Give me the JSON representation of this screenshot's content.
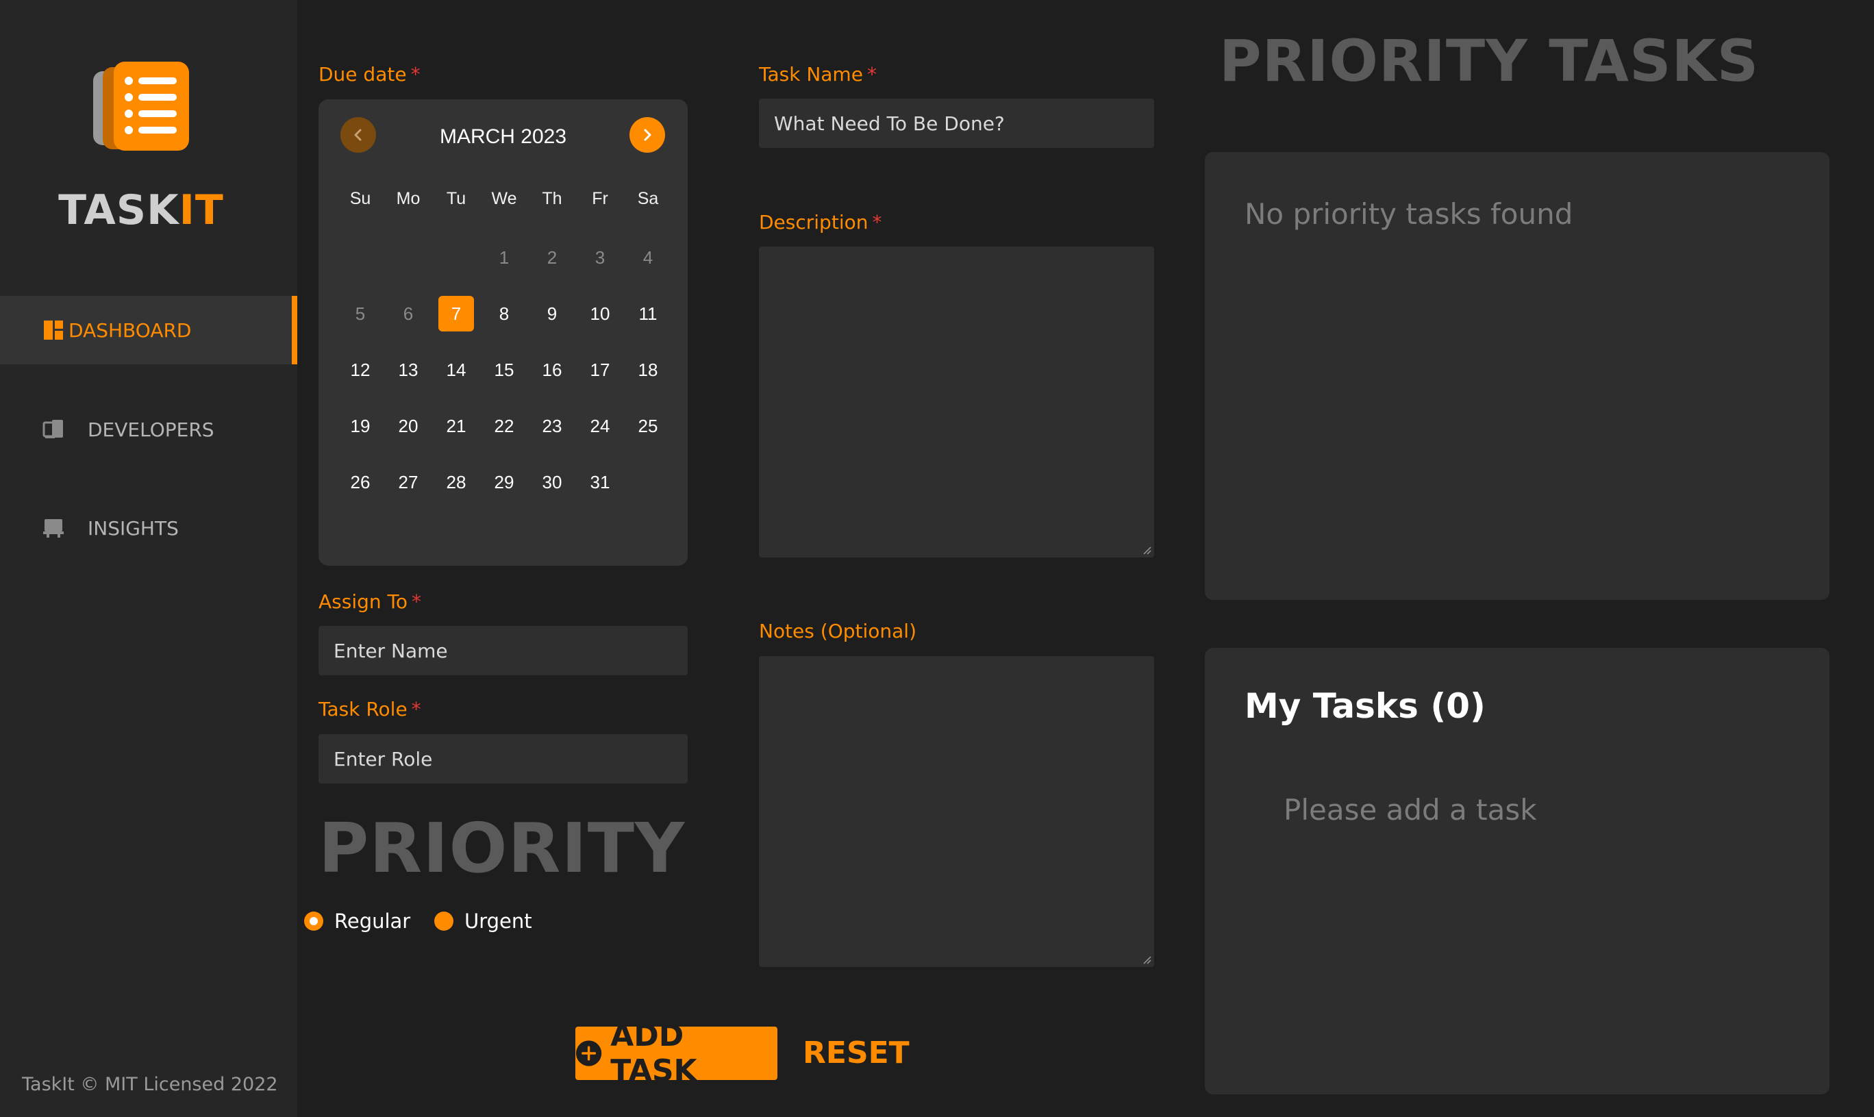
{
  "brand": {
    "part1": "TASK",
    "part2": "IT"
  },
  "nav": [
    {
      "label": "DASHBOARD",
      "active": true,
      "icon": "dashboard-icon"
    },
    {
      "label": "DEVELOPERS",
      "active": false,
      "icon": "developers-icon"
    },
    {
      "label": "INSIGHTS",
      "active": false,
      "icon": "insights-icon"
    }
  ],
  "footer": "TaskIt © MIT Licensed 2022",
  "form": {
    "due_date_label": "Due date",
    "required_mark": "*",
    "calendar": {
      "month": "MARCH 2023",
      "weekdays": [
        "Su",
        "Mo",
        "Tu",
        "We",
        "Th",
        "Fr",
        "Sa"
      ],
      "weeks": [
        [
          "",
          "",
          "",
          "1",
          "2",
          "3",
          "4"
        ],
        [
          "5",
          "6",
          "7",
          "8",
          "9",
          "10",
          "11"
        ],
        [
          "12",
          "13",
          "14",
          "15",
          "16",
          "17",
          "18"
        ],
        [
          "19",
          "20",
          "21",
          "22",
          "23",
          "24",
          "25"
        ],
        [
          "26",
          "27",
          "28",
          "29",
          "30",
          "31",
          ""
        ]
      ],
      "selected_day": "7",
      "disabled_days": [
        "1",
        "2",
        "3",
        "4",
        "5",
        "6"
      ]
    },
    "assign_to_label": "Assign To",
    "assign_to_placeholder": "Enter Name",
    "task_role_label": "Task Role",
    "task_role_placeholder": "Enter Role",
    "priority_title": "PRIORITY",
    "priority_options": [
      {
        "label": "Regular",
        "checked": true
      },
      {
        "label": "Urgent",
        "checked": false
      }
    ],
    "task_name_label": "Task Name",
    "task_name_placeholder": "What Need To Be Done?",
    "description_label": "Description",
    "notes_label": "Notes (Optional)",
    "add_task_label": "ADD TASK",
    "reset_label": "RESET"
  },
  "priority_tasks": {
    "title": "PRIORITY TASKS",
    "empty_text": "No priority tasks found"
  },
  "my_tasks": {
    "title": "My Tasks (0)",
    "empty_text": "Please add a task"
  },
  "colors": {
    "accent": "#ff8c00",
    "background": "#1e1e1e",
    "sidebar": "#262626",
    "panel": "#2e2e2e"
  }
}
